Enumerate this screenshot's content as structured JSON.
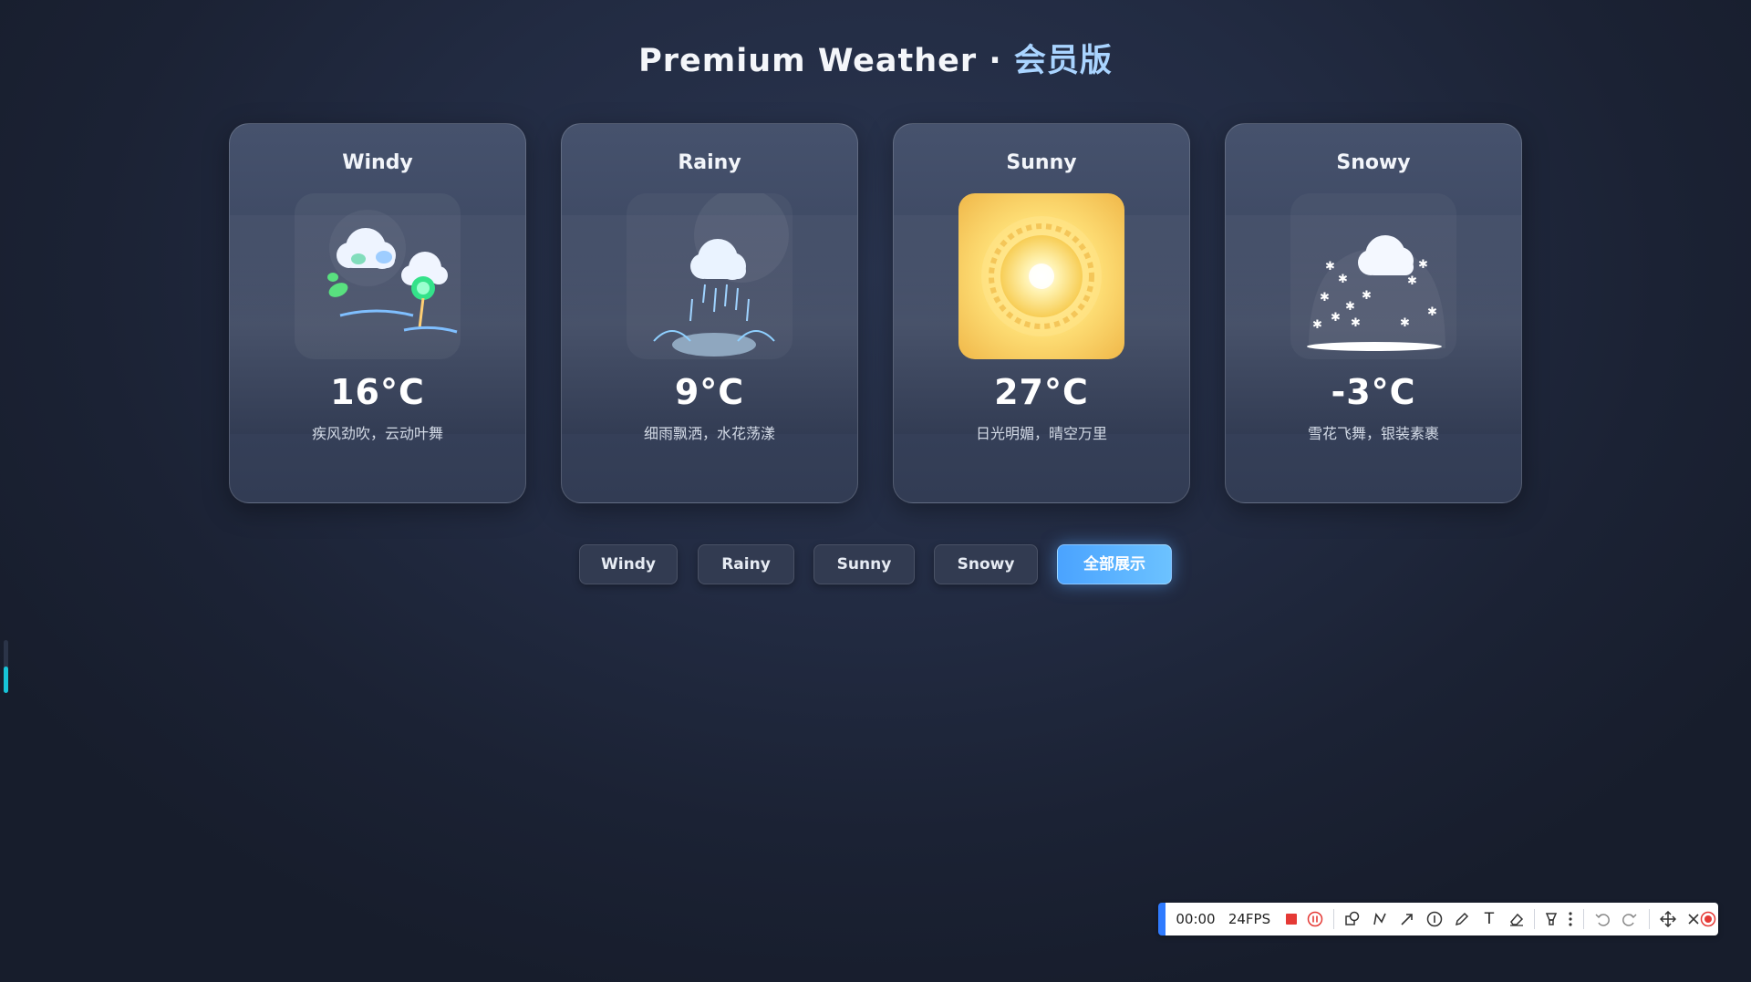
{
  "page": {
    "title_main": "Premium Weather ·",
    "title_accent": "会员版"
  },
  "cards": [
    {
      "name": "Windy",
      "temp": "16°C",
      "desc": "疾风劲吹，云动叶舞",
      "icon": "windy-icon"
    },
    {
      "name": "Rainy",
      "temp": "9°C",
      "desc": "细雨飘洒，水花荡漾",
      "icon": "rain-cloud-icon"
    },
    {
      "name": "Sunny",
      "temp": "27°C",
      "desc": "日光明媚，晴空万里",
      "icon": "sun-icon"
    },
    {
      "name": "Snowy",
      "temp": "-3°C",
      "desc": "雪花飞舞，银装素裹",
      "icon": "snow-cloud-icon"
    }
  ],
  "buttons": [
    {
      "label": "Windy",
      "active": false
    },
    {
      "label": "Rainy",
      "active": false
    },
    {
      "label": "Sunny",
      "active": false
    },
    {
      "label": "Snowy",
      "active": false
    },
    {
      "label": "全部展示",
      "active": true
    }
  ],
  "recorder": {
    "time": "00:00",
    "fps": "24FPS",
    "tools": [
      "stop-record-icon",
      "pause-icon",
      "shapes-icon",
      "polyline-icon",
      "arrow-icon",
      "number-step-icon",
      "pen-icon",
      "text-icon",
      "eraser-icon",
      "highlighter-icon",
      "more-icon",
      "undo-icon",
      "redo-icon",
      "move-icon",
      "close-icon",
      "record-icon"
    ],
    "text_tool": "T",
    "colors": {
      "accent": "#2f7bff",
      "record": "#e53935"
    }
  },
  "side_slider": {
    "level": 0.5,
    "color": "#17c4d8"
  },
  "colors": {
    "active_button": "#4aa3ff",
    "title_accent": "#a9d4ff",
    "sun": "#ffd766"
  }
}
